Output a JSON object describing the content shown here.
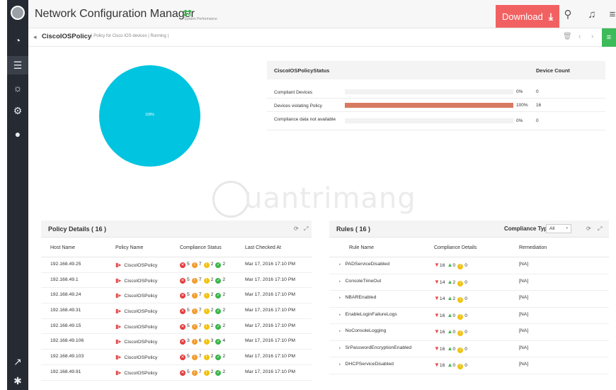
{
  "header": {
    "app_title": "Network Configuration Manager",
    "perf_label": "System Performance",
    "download_label": "Download",
    "brand_color": "#f26162"
  },
  "breadcrumb": {
    "title": "CiscoIOSPolicy",
    "subtitle": "| Policy for Cisco IOS devices | Running |"
  },
  "pie": {
    "label": "100%",
    "color": "#00c4e0"
  },
  "status_table": {
    "col1": "CiscoIOSPolicyStatus",
    "col2": "Device Count",
    "rows": [
      {
        "label": "Compliant Devices",
        "pct": "0%",
        "count": "0",
        "fill": 0
      },
      {
        "label": "Devices violating Policy",
        "pct": "100%",
        "count": "16",
        "fill": 1
      },
      {
        "label": "Compliance data not available",
        "pct": "0%",
        "count": "0",
        "fill": 0
      }
    ]
  },
  "watermark": "uantrimang",
  "policy_details": {
    "title": "Policy Details ( 16 )",
    "columns": [
      "Host Name",
      "Policy Name",
      "Compliance Status",
      "Last Checked At"
    ],
    "rows": [
      {
        "host": "192.168.49.25",
        "policy": "CiscoIOSPolicy",
        "c1": "5",
        "c2": "7",
        "c3": "2",
        "c4": "2",
        "time": "Mar 17, 2016 17:10 PM"
      },
      {
        "host": "192.168.49.1",
        "policy": "CiscoIOSPolicy",
        "c1": "5",
        "c2": "7",
        "c3": "2",
        "c4": "2",
        "time": "Mar 17, 2016 17:10 PM"
      },
      {
        "host": "192.168.49.24",
        "policy": "CiscoIOSPolicy",
        "c1": "5",
        "c2": "7",
        "c3": "2",
        "c4": "2",
        "time": "Mar 17, 2016 17:10 PM"
      },
      {
        "host": "192.168.49.31",
        "policy": "CiscoIOSPolicy",
        "c1": "5",
        "c2": "7",
        "c3": "2",
        "c4": "2",
        "time": "Mar 17, 2016 17:10 PM"
      },
      {
        "host": "192.168.49.15",
        "policy": "CiscoIOSPolicy",
        "c1": "5",
        "c2": "7",
        "c3": "2",
        "c4": "2",
        "time": "Mar 17, 2016 17:10 PM"
      },
      {
        "host": "192.168.49.106",
        "policy": "CiscoIOSPolicy",
        "c1": "3",
        "c2": "6",
        "c3": "3",
        "c4": "4",
        "time": "Mar 17, 2016 17:10 PM"
      },
      {
        "host": "192.168.49.103",
        "policy": "CiscoIOSPolicy",
        "c1": "5",
        "c2": "7",
        "c3": "2",
        "c4": "2",
        "time": "Mar 17, 2016 17:10 PM"
      },
      {
        "host": "192.168.49.91",
        "policy": "CiscoIOSPolicy",
        "c1": "5",
        "c2": "7",
        "c3": "2",
        "c4": "2",
        "time": "Mar 17, 2016 17:10 PM"
      }
    ]
  },
  "rules": {
    "title": "Rules ( 16 )",
    "compliance_type_label": "Compliance Type",
    "compliance_type_value": "All",
    "columns": [
      "Rule Name",
      "Compliance Details",
      "Remediation"
    ],
    "rows": [
      {
        "name": "PADServiceDisabled",
        "down": "16",
        "up": "0",
        "na": "0",
        "remediation": "[NA]"
      },
      {
        "name": "ConsoleTimeOut",
        "down": "14",
        "up": "2",
        "na": "0",
        "remediation": "[NA]"
      },
      {
        "name": "NBAREnabled",
        "down": "14",
        "up": "2",
        "na": "0",
        "remediation": "[NA]"
      },
      {
        "name": "EnableLoginFailureLogs",
        "down": "16",
        "up": "0",
        "na": "0",
        "remediation": "[NA]"
      },
      {
        "name": "NoConsoleLogging",
        "down": "16",
        "up": "0",
        "na": "0",
        "remediation": "[NA]"
      },
      {
        "name": "SrPasswordEncryptionEnabled",
        "down": "16",
        "up": "0",
        "na": "0",
        "remediation": "[NA]"
      },
      {
        "name": "DHCPServiceDisabled",
        "down": "16",
        "up": "0",
        "na": "0",
        "remediation": "[NA]"
      }
    ]
  }
}
